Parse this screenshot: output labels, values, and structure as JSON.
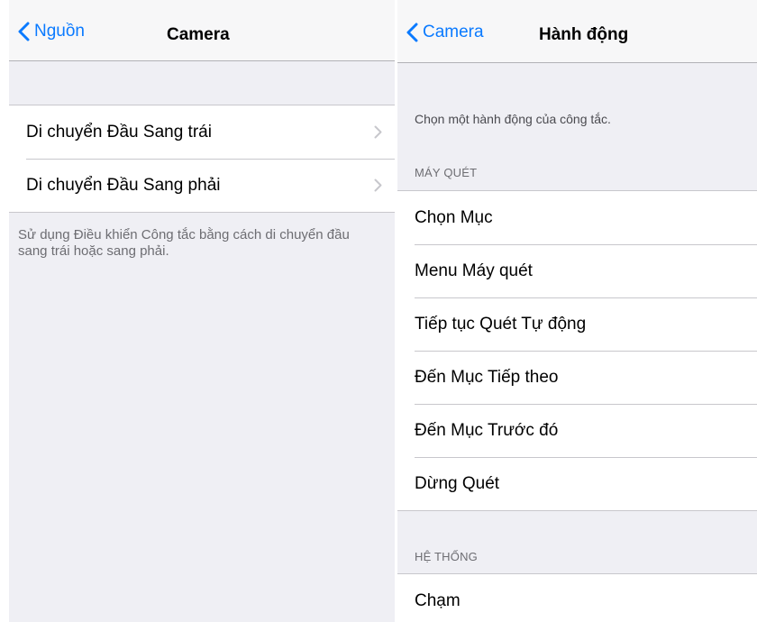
{
  "left_screen": {
    "back_label": "Nguồn",
    "title": "Camera",
    "rows": [
      {
        "label": "Di chuyển Đầu Sang trái"
      },
      {
        "label": "Di chuyển Đầu Sang phải"
      }
    ],
    "footer": "Sử dụng Điều khiển Công tắc bằng cách di chuyển đầu sang trái hoặc sang phải."
  },
  "right_screen": {
    "back_label": "Camera",
    "title": "Hành động",
    "instruction": "Chọn một hành động của công tắc.",
    "scanner_header": "MÁY QUÉT",
    "scanner_items": [
      {
        "label": "Chọn Mục"
      },
      {
        "label": "Menu Máy quét"
      },
      {
        "label": "Tiếp tục Quét Tự động"
      },
      {
        "label": "Đến Mục Tiếp theo"
      },
      {
        "label": "Đến Mục Trước đó"
      },
      {
        "label": "Dừng Quét"
      }
    ],
    "system_header": "HỆ THỐNG",
    "system_items": [
      {
        "label": "Chạm"
      }
    ]
  },
  "colors": {
    "accent": "#0a7aff",
    "grouped_background": "#efeff4",
    "secondary_text": "#6d6d72",
    "separator": "#c8c7cc"
  },
  "icons": {
    "back": "chevron-left-icon",
    "disclosure": "chevron-right-icon"
  }
}
